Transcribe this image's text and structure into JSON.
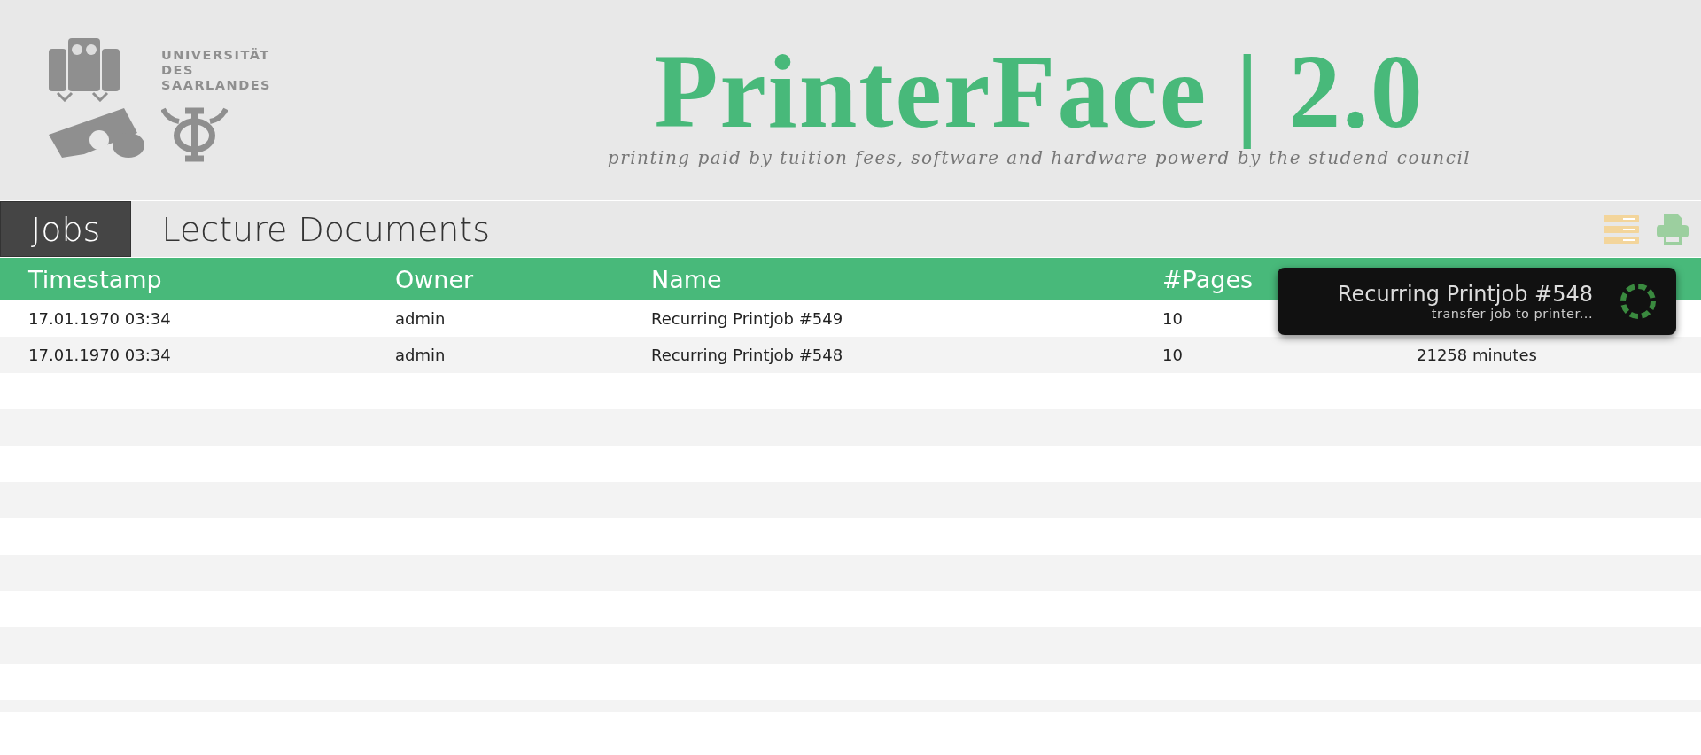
{
  "header": {
    "university": [
      "UNIVERSITÄT",
      "DES",
      "SAARLANDES"
    ],
    "title": "PrinterFace | 2.0",
    "subtitle": "printing paid by tuition fees, software and hardware powerd by the studend council"
  },
  "tabs": [
    {
      "label": "Jobs",
      "selected": true
    },
    {
      "label": "Lecture Documents",
      "selected": false
    }
  ],
  "table": {
    "columns": [
      "Timestamp",
      "Owner",
      "Name",
      "#Pages"
    ],
    "rows": [
      [
        "17.01.1970 03:34",
        "admin",
        "Recurring Printjob #549",
        "10"
      ],
      [
        "17.01.1970 03:34",
        "admin",
        "Recurring Printjob #548",
        "10",
        "21258 minutes"
      ]
    ]
  },
  "toast": {
    "title": "Recurring Printjob #548",
    "message": "transfer job to printer..."
  }
}
